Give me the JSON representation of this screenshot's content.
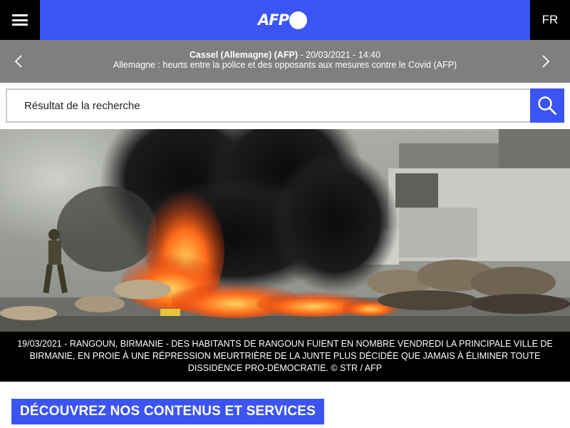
{
  "header": {
    "logo_text": "AFP",
    "lang_label": "FR",
    "brand_color": "#3b55f4",
    "icons": {
      "menu": "hamburger-icon",
      "logo_mark": "circle-dot"
    }
  },
  "ticker": {
    "headline": "Cassel (Allemagne) (AFP)",
    "datetime": " - 20/03/2021 - 14:40",
    "summary": "Allemagne : heurts entre la police et des opposants aux mesures contre le Covid (AFP)",
    "icons": {
      "prev": "chevron-left-icon",
      "next": "chevron-right-icon"
    }
  },
  "search": {
    "value": "",
    "placeholder": "Résultat de la recherche",
    "icon": "search-icon"
  },
  "hero": {
    "caption": "19/03/2021 - RANGOUN, BIRMANIE - DES HABITANTS DE RANGOUN FUIENT EN NOMBRE VENDREDI LA PRINCIPALE VILLE DE BIRMANIE, EN PROIE À UNE RÉPRESSION MEURTRIÈRE DE LA JUNTE PLUS DÉCIDÉE QUE JAMAIS À ÉLIMINER TOUTE DISSIDENCE PRO-DÉMOCRATIE. © STR / AFP"
  },
  "discover": {
    "label": "DÉCOUVREZ NOS CONTENUS ET SERVICES"
  }
}
